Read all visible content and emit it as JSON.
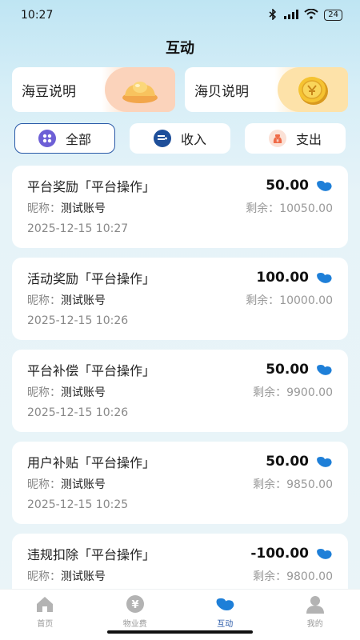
{
  "status": {
    "time": "10:27",
    "battery": "24"
  },
  "page": {
    "title": "互动"
  },
  "explain": {
    "bean_label": "海豆说明",
    "shell_label": "海贝说明"
  },
  "filters": [
    {
      "label": "全部",
      "icon": "grid-icon",
      "active": true
    },
    {
      "label": "收入",
      "icon": "income-icon",
      "active": false
    },
    {
      "label": "支出",
      "icon": "expense-icon",
      "active": false
    }
  ],
  "records": [
    {
      "title": "平台奖励「平台操作」",
      "amount": "50.00",
      "nick_label": "昵称：",
      "nick": "测试账号",
      "remain_label": "剩余：",
      "remain": "10050.00",
      "date": "2025-12-15 10:27"
    },
    {
      "title": "活动奖励「平台操作」",
      "amount": "100.00",
      "nick_label": "昵称：",
      "nick": "测试账号",
      "remain_label": "剩余：",
      "remain": "10000.00",
      "date": "2025-12-15 10:26"
    },
    {
      "title": "平台补偿「平台操作」",
      "amount": "50.00",
      "nick_label": "昵称：",
      "nick": "测试账号",
      "remain_label": "剩余：",
      "remain": "9900.00",
      "date": "2025-12-15 10:26"
    },
    {
      "title": "用户补贴「平台操作」",
      "amount": "50.00",
      "nick_label": "昵称：",
      "nick": "测试账号",
      "remain_label": "剩余：",
      "remain": "9850.00",
      "date": "2025-12-15 10:25"
    },
    {
      "title": "违规扣除「平台操作」",
      "amount": "-100.00",
      "nick_label": "昵称：",
      "nick": "测试账号",
      "remain_label": "剩余：",
      "remain": "9800.00",
      "date": ""
    }
  ],
  "tabbar": [
    {
      "label": "首页",
      "icon": "home-icon",
      "active": false
    },
    {
      "label": "物业费",
      "icon": "yen-icon",
      "active": false
    },
    {
      "label": "互动",
      "icon": "bean-icon",
      "active": true
    },
    {
      "label": "我的",
      "icon": "user-icon",
      "active": false
    }
  ],
  "colors": {
    "accent": "#2a5aa8",
    "bean_blue": "#1e7fd8"
  }
}
